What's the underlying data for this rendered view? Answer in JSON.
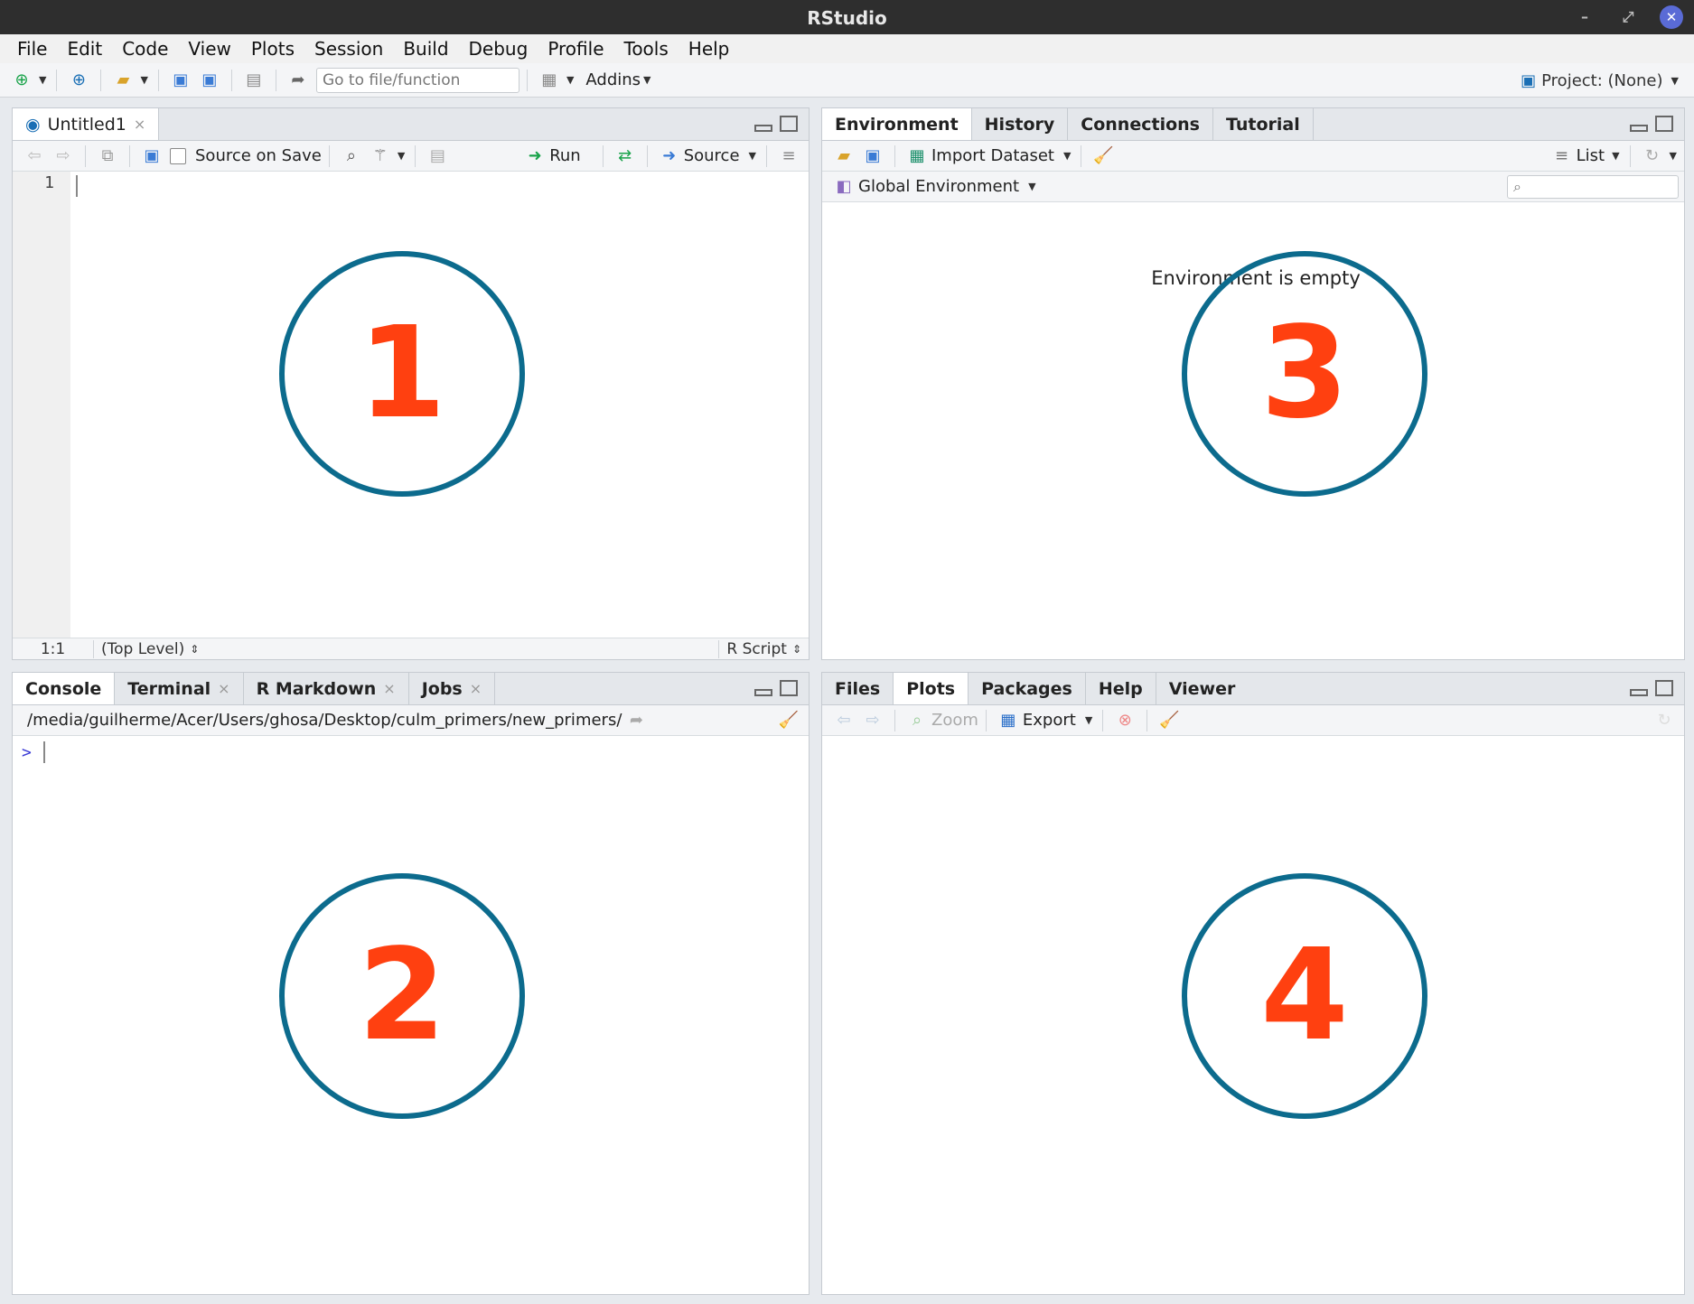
{
  "window": {
    "title": "RStudio"
  },
  "menu": [
    "File",
    "Edit",
    "Code",
    "View",
    "Plots",
    "Session",
    "Build",
    "Debug",
    "Profile",
    "Tools",
    "Help"
  ],
  "toolbar": {
    "goto_placeholder": "Go to file/function",
    "addins": "Addins",
    "project": "Project: (None)"
  },
  "source": {
    "tab": "Untitled1",
    "source_on_save": "Source on Save",
    "run": "Run",
    "source": "Source",
    "line_number": "1",
    "position": "1:1",
    "scope": "(Top Level)",
    "filetype": "R Script"
  },
  "console": {
    "tabs": [
      "Console",
      "Terminal",
      "R Markdown",
      "Jobs"
    ],
    "path": "/media/guilherme/Acer/Users/ghosa/Desktop/culm_primers/new_primers/",
    "prompt": ">"
  },
  "environment": {
    "tabs": [
      "Environment",
      "History",
      "Connections",
      "Tutorial"
    ],
    "import_dataset": "Import Dataset",
    "list": "List",
    "scope": "Global Environment",
    "empty_message": "Environment is empty"
  },
  "files": {
    "tabs": [
      "Files",
      "Plots",
      "Packages",
      "Help",
      "Viewer"
    ],
    "zoom": "Zoom",
    "export": "Export"
  },
  "annotations": [
    "1",
    "2",
    "3",
    "4"
  ],
  "colors": {
    "circle": "#0c6b8d",
    "number": "#ff4010"
  }
}
